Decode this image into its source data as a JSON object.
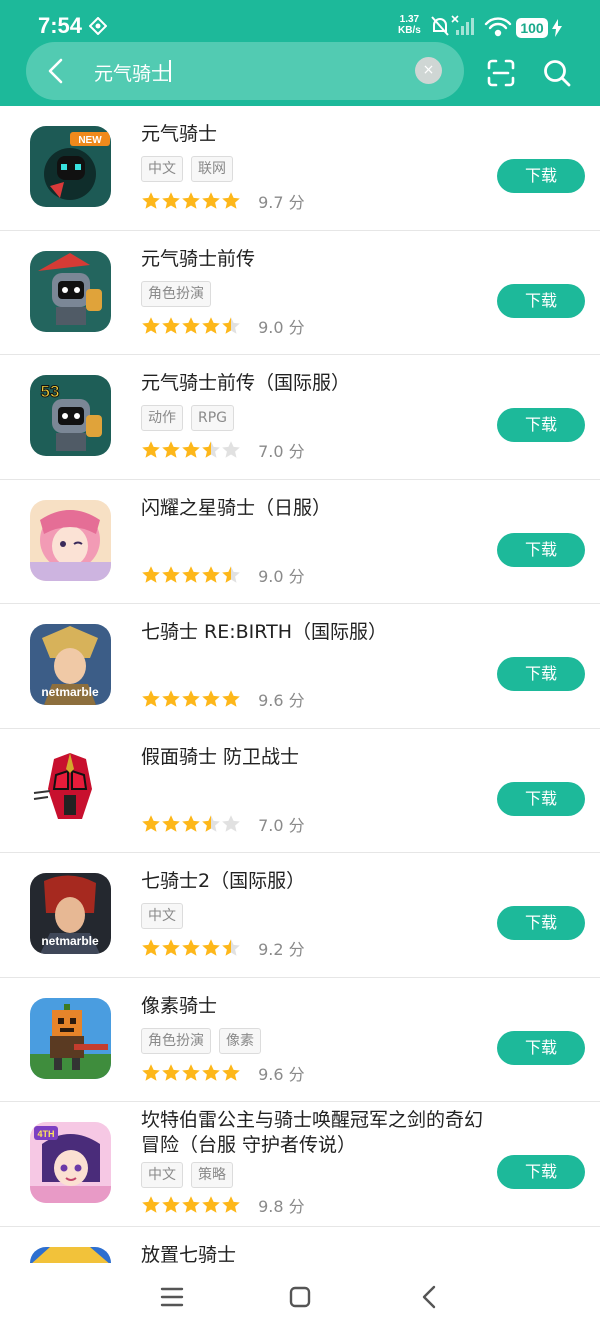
{
  "status_bar": {
    "time": "7:54",
    "speed_value": "1.37",
    "speed_unit": "KB/s",
    "battery": "100"
  },
  "search": {
    "query": "元气骑士",
    "clear_symbol": "×"
  },
  "colors": {
    "brand": "#1db99a",
    "star": "#fdb71a",
    "star_empty": "#e1e1e1"
  },
  "apps": [
    {
      "name": "元气骑士",
      "tags": [
        "中文",
        "联网"
      ],
      "stars": 5,
      "score": "9.7 分",
      "action": "下载"
    },
    {
      "name": "元气骑士前传",
      "tags": [
        "角色扮演"
      ],
      "stars": 4.5,
      "score": "9.0 分",
      "action": "下载"
    },
    {
      "name": "元气骑士前传（国际服）",
      "tags": [
        "动作",
        "RPG"
      ],
      "stars": 3.5,
      "score": "7.0 分",
      "action": "下载"
    },
    {
      "name": "闪耀之星骑士（日服）",
      "tags": [],
      "stars": 4.5,
      "score": "9.0 分",
      "action": "下载"
    },
    {
      "name": "七骑士 RE:BIRTH（国际服）",
      "tags": [],
      "stars": 5,
      "score": "9.6 分",
      "action": "下载"
    },
    {
      "name": "假面骑士 防卫战士",
      "tags": [],
      "stars": 3.5,
      "score": "7.0 分",
      "action": "下载"
    },
    {
      "name": "七骑士2（国际服）",
      "tags": [
        "中文"
      ],
      "stars": 4.5,
      "score": "9.2 分",
      "action": "下载"
    },
    {
      "name": "像素骑士",
      "tags": [
        "角色扮演",
        "像素"
      ],
      "stars": 5,
      "score": "9.6 分",
      "action": "下载"
    },
    {
      "name": "坎特伯雷公主与骑士唤醒冠军之剑的奇幻冒险（台服 守护者传说）",
      "tags": [
        "中文",
        "策略"
      ],
      "stars": 5,
      "score": "9.8 分",
      "action": "下载"
    },
    {
      "name": "放置七骑士",
      "tags": [],
      "stars": 0,
      "score": "",
      "action": ""
    }
  ],
  "icon_labels": {
    "new_badge": "NEW",
    "level_badge": "53",
    "publisher": "netmarble",
    "anniversary": "4TH"
  }
}
